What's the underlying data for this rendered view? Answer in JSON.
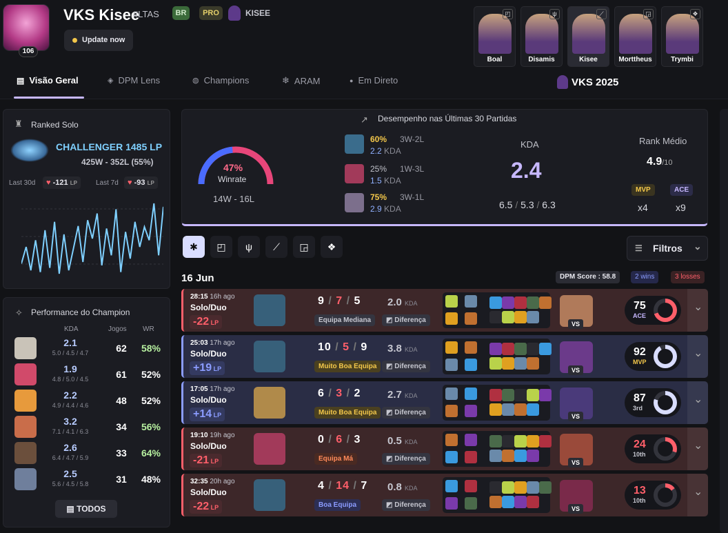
{
  "profile": {
    "name": "VKS Kisee",
    "tag": "#LTAS",
    "level": "106",
    "region": "BR",
    "pro": "PRO",
    "team": "KISEE",
    "update": "Update now"
  },
  "tabs": [
    {
      "label": "Visão Geral"
    },
    {
      "label": "DPM Lens"
    },
    {
      "label": "Champions"
    },
    {
      "label": "ARAM"
    },
    {
      "label": "Em Direto"
    }
  ],
  "team_label": "VKS 2025",
  "roster": [
    {
      "name": "Boal",
      "role": "top"
    },
    {
      "name": "Disamis",
      "role": "jungle"
    },
    {
      "name": "Kisee",
      "role": "mid"
    },
    {
      "name": "Morttheus",
      "role": "bot"
    },
    {
      "name": "Trymbi",
      "role": "support"
    }
  ],
  "ranked": {
    "title": "Ranked Solo",
    "tier": "CHALLENGER 1485 LP",
    "record": "425W - 352L (55%)",
    "last30_label": "Last 30d",
    "last30": "-121",
    "last7_label": "Last 7d",
    "last7": "-93",
    "lp": "LP"
  },
  "lp_history": [
    20,
    40,
    12,
    48,
    10,
    60,
    15,
    70,
    8,
    55,
    12,
    38,
    65,
    22,
    72,
    50,
    80,
    18,
    62,
    30,
    85,
    10,
    58,
    26,
    70,
    40,
    64,
    48,
    92,
    30,
    88
  ],
  "perf": {
    "title": "Performance do Champion",
    "h_kda": "KDA",
    "h_jogos": "Jogos",
    "h_wr": "WR",
    "all": "TODOS",
    "rows": [
      {
        "kda": "2.1",
        "detail": "5.0 / 4.5 / 4.7",
        "games": "62",
        "wr": "58%",
        "win": true,
        "color": "#c9c3b8"
      },
      {
        "kda": "1.9",
        "detail": "4.8 / 5.0 / 4.5",
        "games": "61",
        "wr": "52%",
        "win": false,
        "color": "#d14a6a"
      },
      {
        "kda": "2.2",
        "detail": "4.9 / 4.4 / 4.6",
        "games": "48",
        "wr": "52%",
        "win": false,
        "color": "#e79a3c"
      },
      {
        "kda": "3.2",
        "detail": "7.1 / 4.1 / 6.3",
        "games": "34",
        "wr": "56%",
        "win": true,
        "color": "#c96d4a"
      },
      {
        "kda": "2.6",
        "detail": "6.4 / 4.7 / 5.9",
        "games": "33",
        "wr": "64%",
        "win": true,
        "color": "#6b4f3c"
      },
      {
        "kda": "2.5",
        "detail": "5.6 / 4.5 / 5.8",
        "games": "31",
        "wr": "48%",
        "win": false,
        "color": "#6f7f9c"
      }
    ]
  },
  "summary": {
    "title": "Desempenho nas Últimas 30 Partidas",
    "winrate": "47%",
    "winrate_label": "Winrate",
    "winrate_value": 0.47,
    "record": "14W - 16L",
    "champs": [
      {
        "wr": "60%",
        "wl": "3W-2L",
        "kda": "2.2",
        "color": "#3a6c8c"
      },
      {
        "wr": "25%",
        "wl": "1W-3L",
        "kda": "1.5",
        "color": "#a23a5a"
      },
      {
        "wr": "75%",
        "wl": "3W-1L",
        "kda": "2.9",
        "color": "#7c6f8c"
      }
    ],
    "kda_label": "KDA",
    "kda": "2.4",
    "kda_k": "6.5",
    "kda_d": "5.3",
    "kda_a": "6.3",
    "rank_label": "Rank Médio",
    "rank": "4.9",
    "rank_of": "/10",
    "mvp": "MVP",
    "mvp_count": "x4",
    "ace": "ACE",
    "ace_count": "x9"
  },
  "filters": {
    "label": "Filtros"
  },
  "day": {
    "date": "16 Jun",
    "dpm": "DPM Score : 58.8",
    "wins": "2 wins",
    "losses": "3 losses"
  },
  "games": [
    {
      "duration": "28:15",
      "ago": "16h ago",
      "queue": "Solo/Duo",
      "lp": "-22",
      "win": false,
      "k": "9",
      "d": "7",
      "a": "5",
      "kda": "2.0",
      "team": "Equipa Mediana",
      "diff": "Diferença",
      "score": "75",
      "rank": "ACE",
      "ring": 0.7,
      "champ": "#37607a",
      "vs": "#b07a5a"
    },
    {
      "duration": "25:03",
      "ago": "17h ago",
      "queue": "Solo/Duo",
      "lp": "+19",
      "win": true,
      "k": "10",
      "d": "5",
      "a": "9",
      "kda": "3.8",
      "team": "Muito Boa Equipa",
      "diff": "Diferença",
      "score": "92",
      "rank": "MVP",
      "ring": 0.92,
      "champ": "#37607a",
      "vs": "#6b3a8a"
    },
    {
      "duration": "17:05",
      "ago": "17h ago",
      "queue": "Solo/Duo",
      "lp": "+14",
      "win": true,
      "k": "6",
      "d": "3",
      "a": "2",
      "kda": "2.7",
      "team": "Muito Boa Equipa",
      "diff": "Diferença",
      "score": "87",
      "rank": "3rd",
      "ring": 0.8,
      "champ": "#b08a4a",
      "vs": "#4a3a7a"
    },
    {
      "duration": "19:10",
      "ago": "19h ago",
      "queue": "Solo/Duo",
      "lp": "-21",
      "win": false,
      "k": "0",
      "d": "6",
      "a": "3",
      "kda": "0.5",
      "team": "Equipa Má",
      "diff": "Diferença",
      "score": "24",
      "rank": "10th",
      "ring": 0.3,
      "champ": "#a23a5a",
      "vs": "#9a4a3a"
    },
    {
      "duration": "32:35",
      "ago": "20h ago",
      "queue": "Solo/Duo",
      "lp": "-22",
      "win": false,
      "k": "4",
      "d": "14",
      "a": "7",
      "kda": "0.8",
      "team": "Boa Equipa",
      "diff": "Diferença",
      "score": "13",
      "rank": "10th",
      "ring": 0.15,
      "champ": "#37607a",
      "vs": "#7a2a4a"
    }
  ],
  "colors": {
    "accent": "#c7b8ff",
    "win": "#8b9cff",
    "loss": "#ff5f6a",
    "gold": "#f3c74a",
    "wr_good": "#b7f0a0"
  }
}
